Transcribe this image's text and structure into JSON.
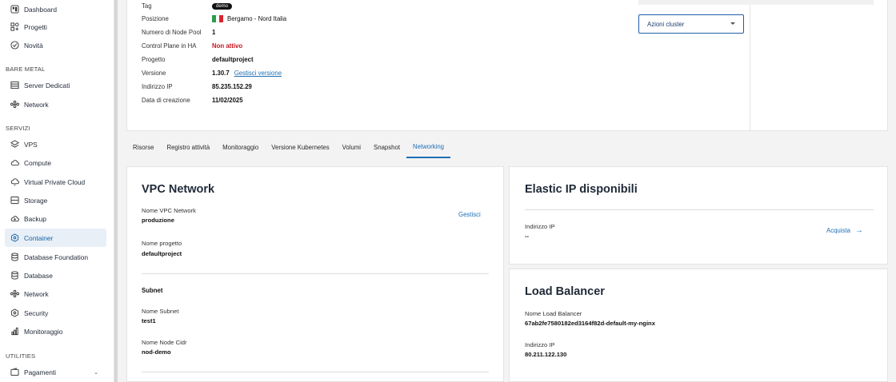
{
  "sidebar": {
    "items_top": [
      {
        "label": "Dashboard",
        "icon": "dashboard-icon"
      },
      {
        "label": "Progetti",
        "icon": "projects-icon"
      },
      {
        "label": "Novità",
        "icon": "news-icon"
      }
    ],
    "section_bare_metal": "BARE METAL",
    "items_bare_metal": [
      {
        "label": "Server Dedicati",
        "icon": "server-icon"
      },
      {
        "label": "Network",
        "icon": "network-icon"
      }
    ],
    "section_servizi": "SERVIZI",
    "items_servizi": [
      {
        "label": "VPS",
        "icon": "vps-icon"
      },
      {
        "label": "Compute",
        "icon": "cloud-icon"
      },
      {
        "label": "Virtual Private Cloud",
        "icon": "vpc-icon"
      },
      {
        "label": "Storage",
        "icon": "storage-icon"
      },
      {
        "label": "Backup",
        "icon": "backup-icon"
      },
      {
        "label": "Container",
        "icon": "container-icon"
      },
      {
        "label": "Database Foundation",
        "icon": "database-icon"
      },
      {
        "label": "Database",
        "icon": "database-icon"
      },
      {
        "label": "Network",
        "icon": "network-icon"
      },
      {
        "label": "Security",
        "icon": "security-icon"
      },
      {
        "label": "Monitoraggio",
        "icon": "chart-icon"
      }
    ],
    "section_utilities": "UTILITIES",
    "items_utilities": [
      {
        "label": "Pagamenti",
        "icon": "wallet-icon"
      }
    ],
    "active": "Container"
  },
  "cluster_info": {
    "rows": [
      {
        "label": "Tag",
        "value": "demo"
      },
      {
        "label": "Posizione",
        "value": "Bergamo - Nord Italia"
      },
      {
        "label": "Numero di Node Pool",
        "value": "1"
      },
      {
        "label": "Control Plane in HA",
        "value": "Non attivo"
      },
      {
        "label": "Progetto",
        "value": "defaultproject"
      },
      {
        "label": "Versione",
        "value": "1.30.7",
        "link": "Gestisci versione"
      },
      {
        "label": "Indirizzo IP",
        "value": "85.235.152.29"
      },
      {
        "label": "Data di creazione",
        "value": "11/02/2025"
      }
    ],
    "cluster_actions_label": "Azioni cluster"
  },
  "tabs": [
    "Risorse",
    "Registro attività",
    "Monitoraggio",
    "Versione Kubernetes",
    "Volumi",
    "Snapshot",
    "Networking"
  ],
  "active_tab": "Networking",
  "vpc": {
    "title": "VPC Network",
    "name_label": "Nome VPC Network",
    "name_value": "produzione",
    "manage_label": "Gestisci",
    "project_label": "Nome progetto",
    "project_value": "defaultproject",
    "subnet_heading": "Subnet",
    "subnet_label": "Nome Subnet",
    "subnet_value": "test1",
    "cidr_label": "Nome Node Cidr",
    "cidr_value": "nod-demo"
  },
  "elastic_ip": {
    "title": "Elastic IP disponibili",
    "ip_label": "Indirizzo IP",
    "ip_value": "--",
    "buy_label": "Acquista"
  },
  "load_balancer": {
    "title": "Load Balancer",
    "name_label": "Nome Load Balancer",
    "name_value": "67ab2fe7580182ed3164f82d-default-my-nginx",
    "ip_label": "Indirizzo IP",
    "ip_value": "80.211.122.130"
  },
  "colors": {
    "accent": "#1f6fb5",
    "danger": "#c4141c",
    "flag_green": "#2e9b48",
    "flag_white": "#ffffff",
    "flag_red": "#d8262e"
  }
}
